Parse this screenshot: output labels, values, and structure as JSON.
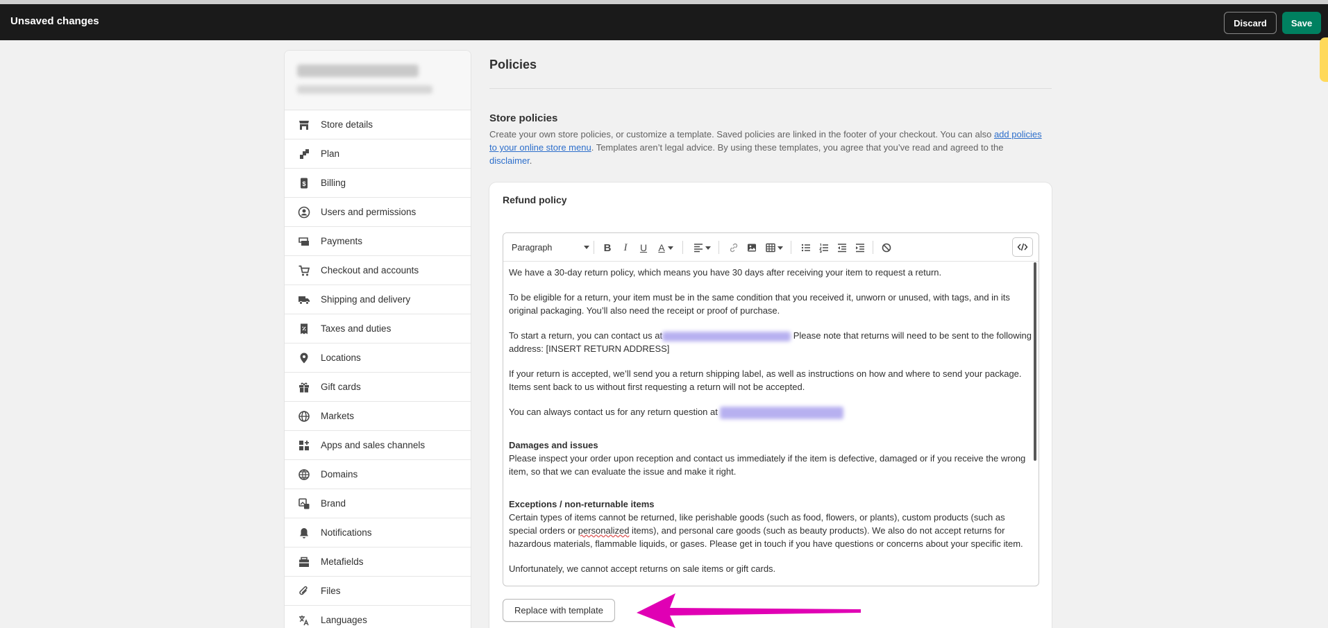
{
  "topbar": {
    "title": "Unsaved changes",
    "discard": "Discard",
    "save": "Save"
  },
  "nav": {
    "items": [
      {
        "label": "Store details",
        "icon": "store-icon"
      },
      {
        "label": "Plan",
        "icon": "plan-icon"
      },
      {
        "label": "Billing",
        "icon": "billing-icon"
      },
      {
        "label": "Users and permissions",
        "icon": "user-icon"
      },
      {
        "label": "Payments",
        "icon": "payments-icon"
      },
      {
        "label": "Checkout and accounts",
        "icon": "cart-icon"
      },
      {
        "label": "Shipping and delivery",
        "icon": "truck-icon"
      },
      {
        "label": "Taxes and duties",
        "icon": "receipt-icon"
      },
      {
        "label": "Locations",
        "icon": "location-pin-icon"
      },
      {
        "label": "Gift cards",
        "icon": "gift-icon"
      },
      {
        "label": "Markets",
        "icon": "globe-icon"
      },
      {
        "label": "Apps and sales channels",
        "icon": "apps-icon"
      },
      {
        "label": "Domains",
        "icon": "domain-globe-icon"
      },
      {
        "label": "Brand",
        "icon": "brand-icon"
      },
      {
        "label": "Notifications",
        "icon": "bell-icon"
      },
      {
        "label": "Metafields",
        "icon": "metafields-icon"
      },
      {
        "label": "Files",
        "icon": "paperclip-icon"
      },
      {
        "label": "Languages",
        "icon": "language-icon"
      }
    ]
  },
  "main": {
    "title": "Policies",
    "section_title": "Store policies",
    "desc_part1": "Create your own store policies, or customize a template. Saved policies are linked in the footer of your checkout. You can also ",
    "desc_link1": "add policies to your online store menu",
    "desc_part2": ". Templates aren’t legal advice. By using these templates, you agree that you’ve read and agreed to the ",
    "desc_link2": "disclaimer",
    "desc_part3": "."
  },
  "refund": {
    "title": "Refund policy",
    "format": "Paragraph",
    "p1": "We have a 30-day return policy, which means you have 30 days after receiving your item to request a return.",
    "p2": "To be eligible for a return, your item must be in the same condition that you received it, unworn or unused, with tags, and in its original packaging. You’ll also need the receipt or proof of purchase.",
    "p3a": "To start a return, you can contact us at",
    "p3b": " Please note that returns will need to be sent to the following address: [INSERT RETURN ADDRESS]",
    "p4": "If your return is accepted, we’ll send you a return shipping label, as well as instructions on how and where to send your package. Items sent back to us without first requesting a return will not be accepted.",
    "p5": "You can always contact us for any return question at ",
    "h1": "Damages and issues",
    "p6": "Please inspect your order upon reception and contact us immediately if the item is defective, damaged or if you receive the wrong item, so that we can evaluate the issue and make it right.",
    "h2": "Exceptions / non-returnable items",
    "p7a": "Certain types of items cannot be returned, like perishable goods (such as food, flowers, or plants), custom products (such as special orders or ",
    "p7b": "personalized",
    "p7c": " items), and personal care goods (such as beauty products). We also do not accept returns for hazardous materials, flammable liquids, or gases. Please get in touch if you have questions or concerns about your specific item.",
    "p8": "Unfortunately, we cannot accept returns on sale items or gift cards.",
    "replace_button": "Replace with template"
  },
  "colors": {
    "accent": "#008060",
    "link": "#2c6ecb",
    "arrow": "#e000b4",
    "topbar": "#1a1a1a"
  }
}
